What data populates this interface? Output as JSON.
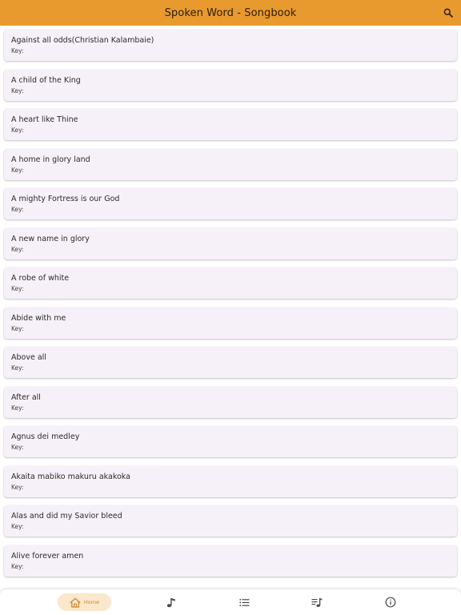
{
  "app_bar": {
    "title": "Spoken Word - Songbook",
    "background": "#e89a2e",
    "action_icon": "search-icon"
  },
  "songs": [
    {
      "title": "Against all odds(Christian Kalambaie)",
      "key_label": "Key:"
    },
    {
      "title": "A child of the King",
      "key_label": "Key:"
    },
    {
      "title": "A heart like Thine",
      "key_label": "Key:"
    },
    {
      "title": "A home in glory land",
      "key_label": "Key:"
    },
    {
      "title": "A mighty Fortress is our God",
      "key_label": "Key:"
    },
    {
      "title": "A new name in glory",
      "key_label": "Key:"
    },
    {
      "title": "A robe of white",
      "key_label": "Key:"
    },
    {
      "title": "Abide with me",
      "key_label": "Key:"
    },
    {
      "title": "Above all",
      "key_label": "Key:"
    },
    {
      "title": "After all",
      "key_label": "Key:"
    },
    {
      "title": "Agnus dei medley",
      "key_label": "Key:"
    },
    {
      "title": "Akaita mabiko makuru akakoka",
      "key_label": "Key:"
    },
    {
      "title": "Alas and did my Savior bleed",
      "key_label": "Key:"
    },
    {
      "title": "Alive forever amen",
      "key_label": "Key:"
    }
  ],
  "bottom_nav": {
    "items": [
      {
        "label": "Home",
        "icon": "home-icon",
        "selected": true
      },
      {
        "label": "",
        "icon": "music-note-icon",
        "selected": false
      },
      {
        "label": "",
        "icon": "list-icon",
        "selected": false
      },
      {
        "label": "",
        "icon": "playlist-music-icon",
        "selected": false
      },
      {
        "label": "",
        "icon": "info-icon",
        "selected": false
      }
    ],
    "selected_color": "#c88a3a",
    "selected_background": "#fbe7cc"
  }
}
